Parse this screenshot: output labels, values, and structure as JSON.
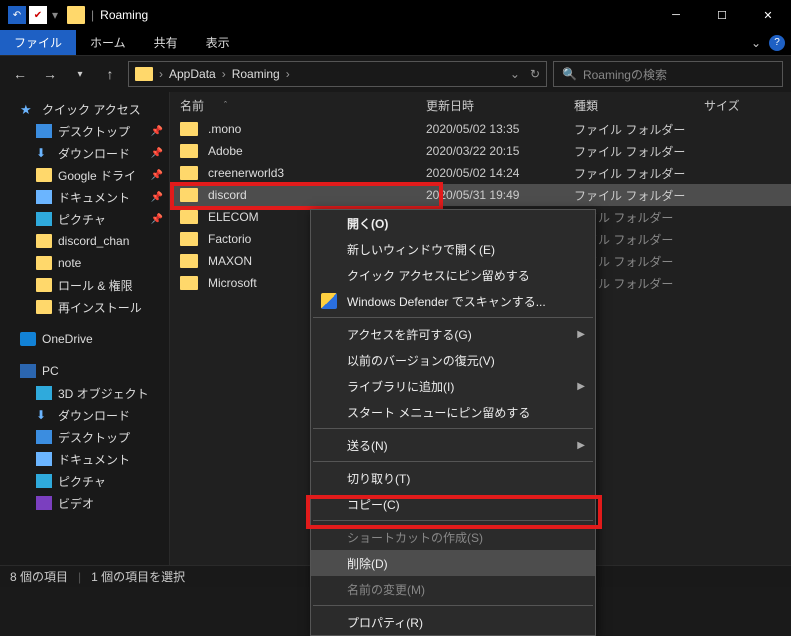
{
  "title": "Roaming",
  "ribbon": {
    "file": "ファイル",
    "home": "ホーム",
    "share": "共有",
    "view": "表示"
  },
  "breadcrumb": {
    "parent": "AppData",
    "current": "Roaming"
  },
  "search_placeholder": "Roamingの検索",
  "columns": {
    "name": "名前",
    "date": "更新日時",
    "type": "種類",
    "size": "サイズ"
  },
  "rows": [
    {
      "name": ".mono",
      "date": "2020/05/02 13:35",
      "type": "ファイル フォルダー"
    },
    {
      "name": "Adobe",
      "date": "2020/03/22 20:15",
      "type": "ファイル フォルダー"
    },
    {
      "name": "creenerworld3",
      "date": "2020/05/02 14:24",
      "type": "ファイル フォルダー"
    },
    {
      "name": "discord",
      "date": "2020/05/31 19:49",
      "type": "ファイル フォルダー",
      "selected": true
    },
    {
      "name": "ELECOM",
      "date": "",
      "type": "ァイル フォルダー"
    },
    {
      "name": "Factorio",
      "date": "",
      "type": "ァイル フォルダー"
    },
    {
      "name": "MAXON",
      "date": "",
      "type": "ァイル フォルダー"
    },
    {
      "name": "Microsoft",
      "date": "",
      "type": "ァイル フォルダー"
    }
  ],
  "sidebar": {
    "quick": "クイック アクセス",
    "items": [
      "デスクトップ",
      "ダウンロード",
      "Google ドライ",
      "ドキュメント",
      "ピクチャ",
      "discord_chan",
      "note",
      "ロール & 権限",
      "再インストール"
    ],
    "onedrive": "OneDrive",
    "pc": "PC",
    "pcitems": [
      "3D オブジェクト",
      "ダウンロード",
      "デスクトップ",
      "ドキュメント",
      "ピクチャ",
      "ビデオ"
    ]
  },
  "context": {
    "open": "開く(O)",
    "open_new": "新しいウィンドウで開く(E)",
    "pin_quick": "クイック アクセスにピン留めする",
    "defender": "Windows Defender でスキャンする...",
    "access": "アクセスを許可する(G)",
    "restore": "以前のバージョンの復元(V)",
    "library": "ライブラリに追加(I)",
    "pin_start": "スタート メニューにピン留めする",
    "sendto": "送る(N)",
    "cut": "切り取り(T)",
    "copy": "コピー(C)",
    "shortcut": "ショートカットの作成(S)",
    "delete": "削除(D)",
    "rename": "名前の変更(M)",
    "properties": "プロパティ(R)"
  },
  "status": {
    "count": "8 個の項目",
    "sel": "1 個の項目を選択"
  }
}
